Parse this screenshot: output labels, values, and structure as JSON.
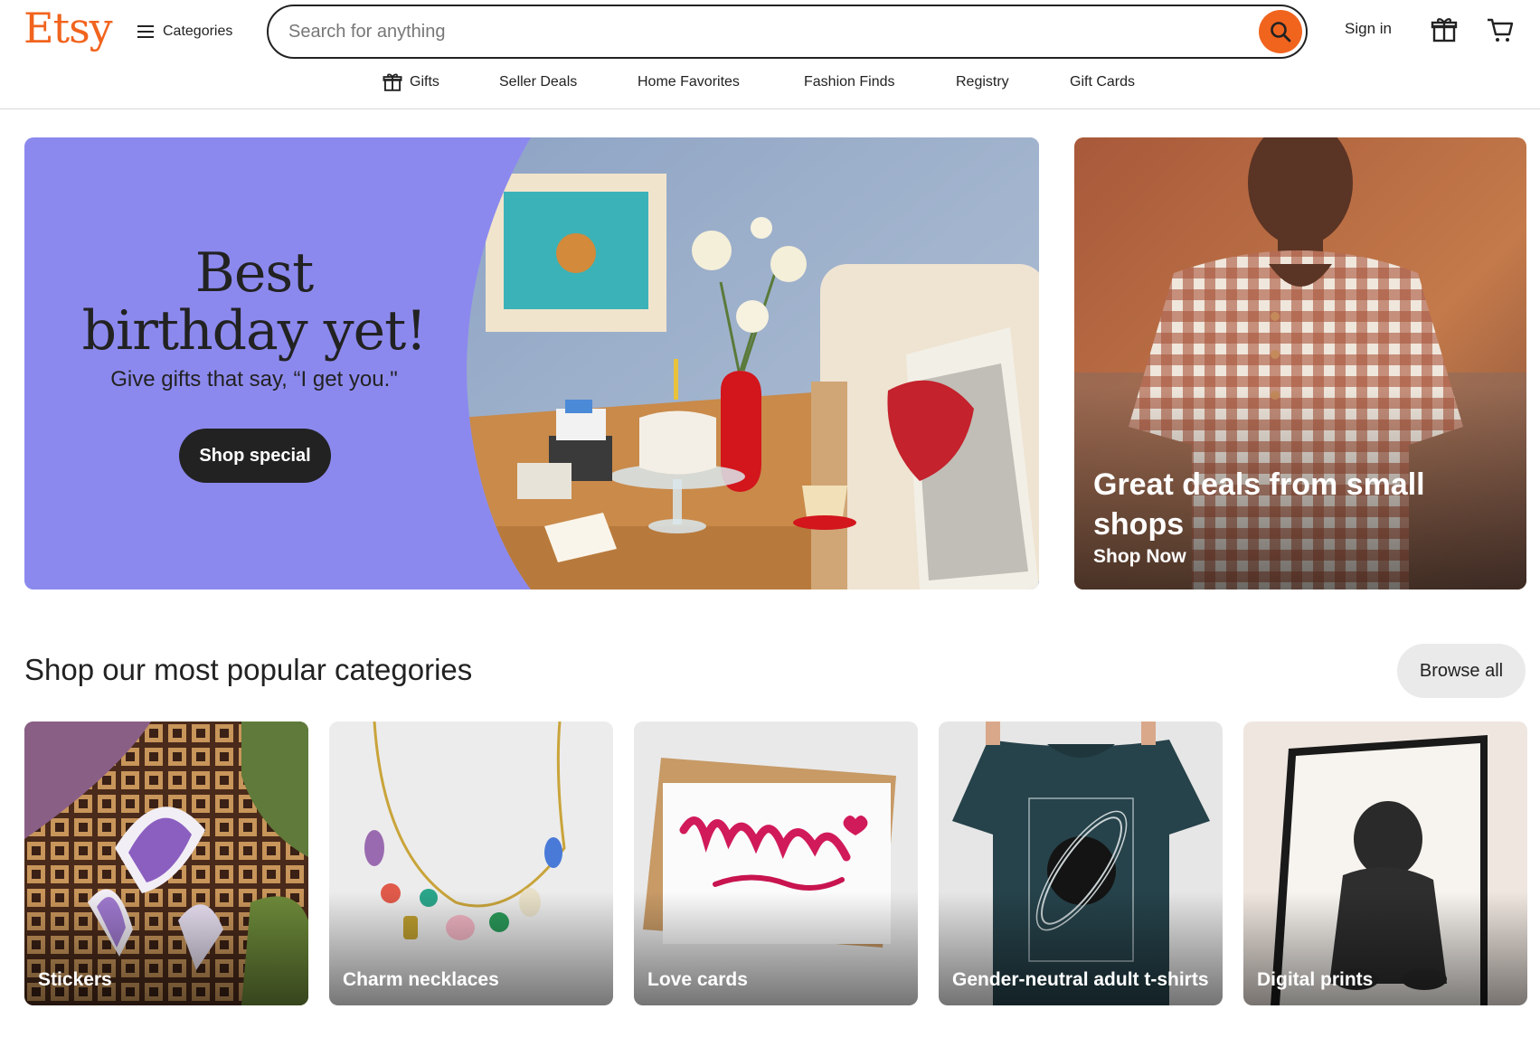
{
  "header": {
    "logo": "Etsy",
    "categories_label": "Categories",
    "search_placeholder": "Search for anything",
    "signin_label": "Sign in",
    "icons": {
      "menu": "hamburger-icon",
      "search": "search-icon",
      "gift": "gift-icon",
      "cart": "cart-icon"
    },
    "nav": [
      {
        "label": "Gifts",
        "icon": "gift-icon"
      },
      {
        "label": "Seller Deals"
      },
      {
        "label": "Home Favorites"
      },
      {
        "label": "Fashion Finds"
      },
      {
        "label": "Registry"
      },
      {
        "label": "Gift Cards"
      }
    ]
  },
  "hero": {
    "title_line1": "Best",
    "title_line2": "birthday yet!",
    "subtitle": "Give gifts that say, “I get you.\"",
    "button_label": "Shop special"
  },
  "deal": {
    "title": "Great deals from small shops",
    "link": "Shop Now"
  },
  "popular": {
    "title": "Shop our most popular categories",
    "browse_label": "Browse all",
    "items": [
      {
        "label": "Stickers"
      },
      {
        "label": "Charm necklaces"
      },
      {
        "label": "Love cards"
      },
      {
        "label": "Gender-neutral adult t-shirts"
      },
      {
        "label": "Digital prints"
      }
    ]
  },
  "colors": {
    "brand": "#f1641e",
    "hero_bg": "#8c89ee",
    "text": "#222222",
    "button_dark": "#222222",
    "browse_bg": "#eaeaea"
  }
}
